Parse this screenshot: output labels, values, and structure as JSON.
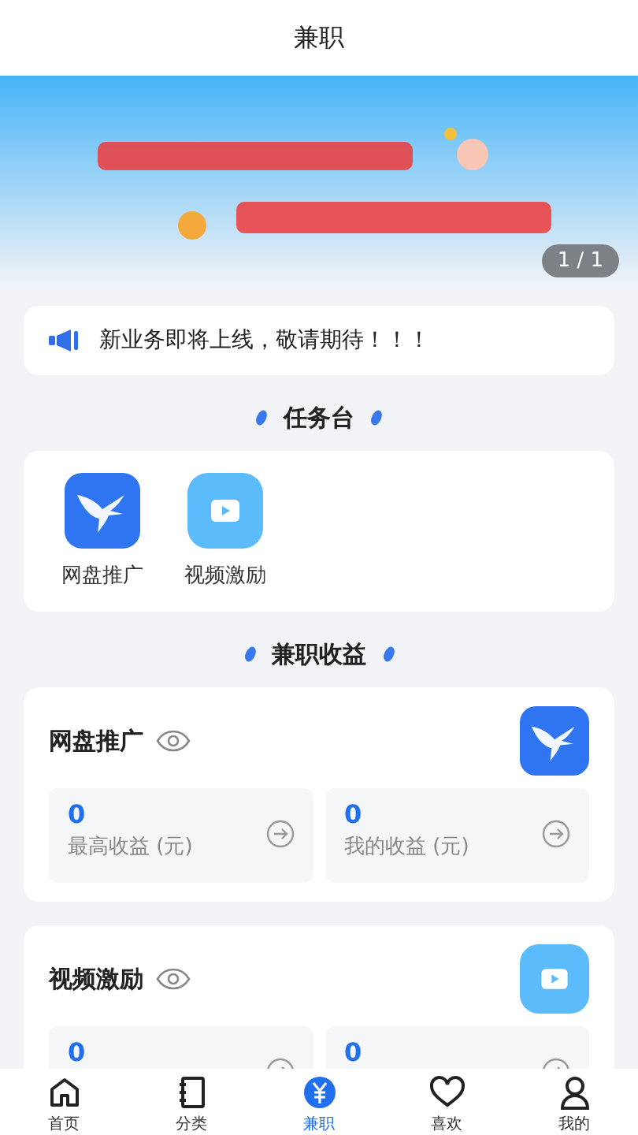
{
  "header": {
    "title": "兼职"
  },
  "banner": {
    "counter": "1 / 1"
  },
  "notice": {
    "text": "新业务即将上线，敬请期待！！！"
  },
  "tasks": {
    "title": "任务台",
    "items": [
      {
        "label": "网盘推广",
        "kind": "bird"
      },
      {
        "label": "视频激励",
        "kind": "video"
      }
    ]
  },
  "income": {
    "title": "兼职收益",
    "cards": [
      {
        "title": "网盘推广",
        "kind": "bird",
        "stats": [
          {
            "value": "0",
            "label": "最高收益 (元)"
          },
          {
            "value": "0",
            "label": "我的收益 (元)"
          }
        ]
      },
      {
        "title": "视频激励",
        "kind": "video",
        "stats": [
          {
            "value": "0"
          },
          {
            "value": "0"
          }
        ]
      }
    ]
  },
  "tabbar": [
    {
      "label": "首页",
      "kind": "home",
      "selected": false
    },
    {
      "label": "分类",
      "kind": "category",
      "selected": false
    },
    {
      "label": "兼职",
      "kind": "job",
      "selected": true
    },
    {
      "label": "喜欢",
      "kind": "like",
      "selected": false
    },
    {
      "label": "我的",
      "kind": "me",
      "selected": false
    }
  ]
}
